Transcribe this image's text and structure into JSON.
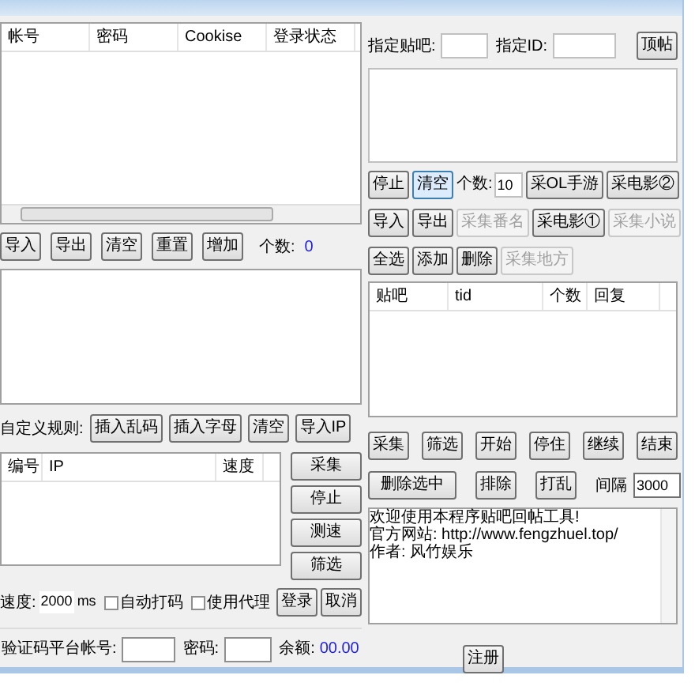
{
  "accounts_table": {
    "columns": [
      "帐号",
      "密码",
      "Cookise",
      "登录状态"
    ]
  },
  "account_actions": {
    "buttons": [
      "导入",
      "导出",
      "清空",
      "重置",
      "增加"
    ],
    "count_label": "个数:",
    "count": "0"
  },
  "rule_row": {
    "label": "自定义规则:",
    "buttons": [
      "插入乱码",
      "插入字母",
      "清空",
      "导入IP"
    ]
  },
  "proxy_table": {
    "columns": [
      "编号",
      "IP",
      "速度"
    ]
  },
  "proxy_buttons": [
    "采集",
    "停止",
    "测速",
    "筛选"
  ],
  "login_row": {
    "speed_label": "速度:",
    "speed_value": "2000",
    "speed_unit": "ms",
    "checkboxes": [
      {
        "label": "自动打码",
        "checked": false
      },
      {
        "label": "使用代理",
        "checked": false
      }
    ],
    "buttons": [
      "登录",
      "取消"
    ]
  },
  "captcha_row": {
    "account_label": "验证码平台帐号:",
    "password_label": "密码:",
    "balance_label": "余额:",
    "balance": "00.00"
  },
  "target_row": {
    "forum_label": "指定贴吧:",
    "id_label": "指定ID:",
    "button": "顶帖"
  },
  "tool_rows": [
    [
      {
        "kind": "button",
        "label": "停止",
        "disabled": false,
        "selected": false
      },
      {
        "kind": "button",
        "label": "清空",
        "disabled": false,
        "selected": true
      },
      {
        "kind": "count",
        "label": "个数:",
        "value": "10"
      },
      {
        "kind": "button",
        "label": "采OL手游",
        "disabled": false,
        "selected": false
      },
      {
        "kind": "button",
        "label": "采电影②",
        "disabled": false,
        "selected": false
      }
    ],
    [
      {
        "kind": "button",
        "label": "导入",
        "disabled": false,
        "selected": false
      },
      {
        "kind": "button",
        "label": "导出",
        "disabled": false,
        "selected": false
      },
      {
        "kind": "button",
        "label": "采集番名",
        "disabled": true,
        "selected": false
      },
      {
        "kind": "button",
        "label": "采电影①",
        "disabled": false,
        "selected": false
      },
      {
        "kind": "button",
        "label": "采集小说",
        "disabled": true,
        "selected": false
      }
    ],
    [
      {
        "kind": "button",
        "label": "全选",
        "disabled": false,
        "selected": false
      },
      {
        "kind": "button",
        "label": "添加",
        "disabled": false,
        "selected": false
      },
      {
        "kind": "button",
        "label": "删除",
        "disabled": false,
        "selected": false
      },
      {
        "kind": "button",
        "label": "采集地方",
        "disabled": true,
        "selected": false
      }
    ]
  ],
  "posts_table": {
    "columns": [
      "贴吧",
      "tid",
      "个数",
      "回复"
    ]
  },
  "post_actions": [
    "采集",
    "筛选",
    "开始",
    "停住",
    "继续",
    "结束"
  ],
  "filter_row": {
    "buttons": [
      "删除选中",
      "排除",
      "打乱"
    ],
    "interval_label": "间隔",
    "interval": "3000"
  },
  "log": {
    "lines": [
      "欢迎使用本程序贴吧回帖工具!",
      "官方网站: http://www.fengzhuel.top/",
      "作者: 风竹娱乐"
    ]
  },
  "footer_buttons": [
    "注册"
  ]
}
